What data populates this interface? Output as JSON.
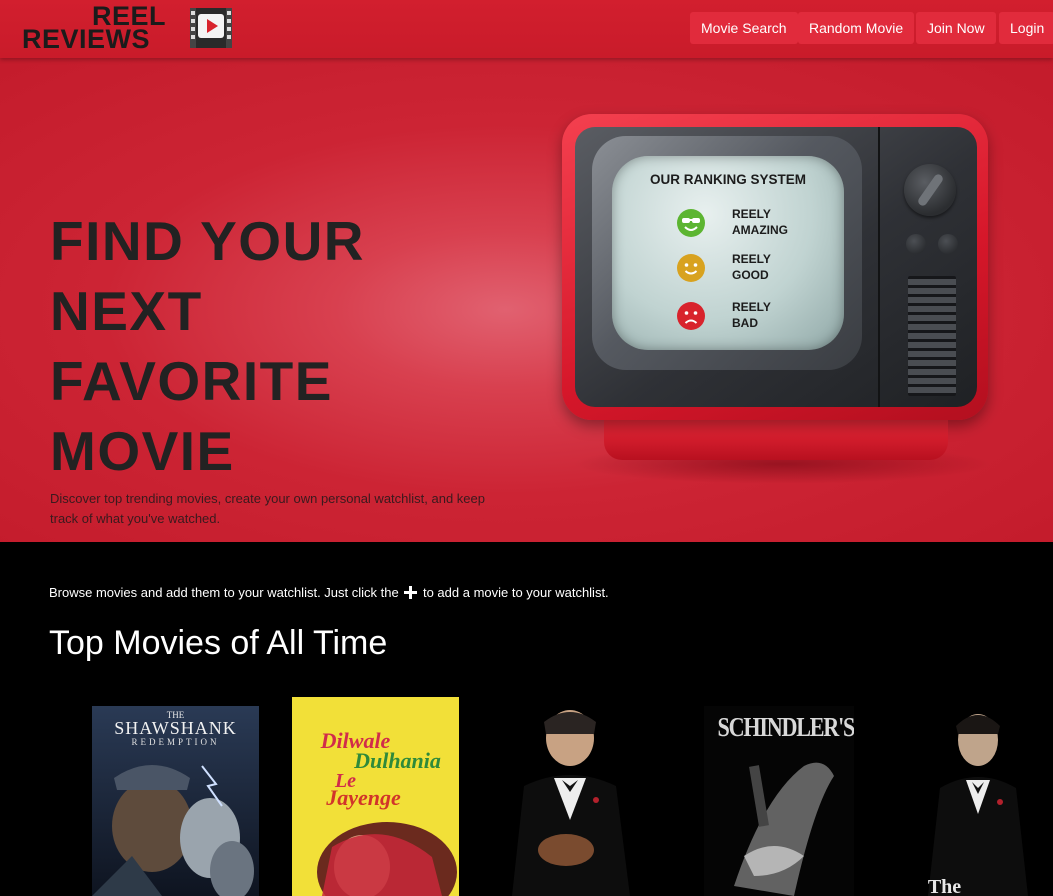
{
  "nav": {
    "logo_line1": "REEL",
    "logo_line2": "REVIEWS",
    "links": [
      "Movie Search",
      "Random Movie",
      "Join Now",
      "Login"
    ]
  },
  "hero": {
    "title_lines": [
      "FIND YOUR",
      "NEXT",
      "FAVORITE",
      "MOVIE"
    ],
    "subtitle": "Discover top trending movies, create your own personal watchlist, and keep track of what you've watched."
  },
  "ranking": {
    "title": "OUR RANKING SYSTEM",
    "items": [
      {
        "line1": "REELY",
        "line2": "AMAZING",
        "color": "#5cb531"
      },
      {
        "line1": "REELY",
        "line2": "GOOD",
        "color": "#d8a21f"
      },
      {
        "line1": "REELY",
        "line2": "BAD",
        "color": "#d8232c"
      }
    ]
  },
  "browse": {
    "text_before": "Browse movies and add them to your watchlist. Just click the",
    "text_after": "to add a movie to your watchlist.",
    "icon": "plus-icon"
  },
  "section_title": "Top Movies of All Time",
  "posters": {
    "shawshank_top": "THE",
    "shawshank_title": "SHAWSHANK",
    "shawshank_sub": "REDEMPTION",
    "ddlj_line1": "Dilwale",
    "ddlj_line2": "Dulhania",
    "ddlj_line3": "Le",
    "ddlj_line4": "Jayenge",
    "schindler_title": "SCHINDLER'S LIST",
    "godfather2_mark": "The"
  },
  "colors": {
    "brand_red": "#c91b2a",
    "nav_button": "#e12b3c",
    "hero_text": "#222222"
  }
}
